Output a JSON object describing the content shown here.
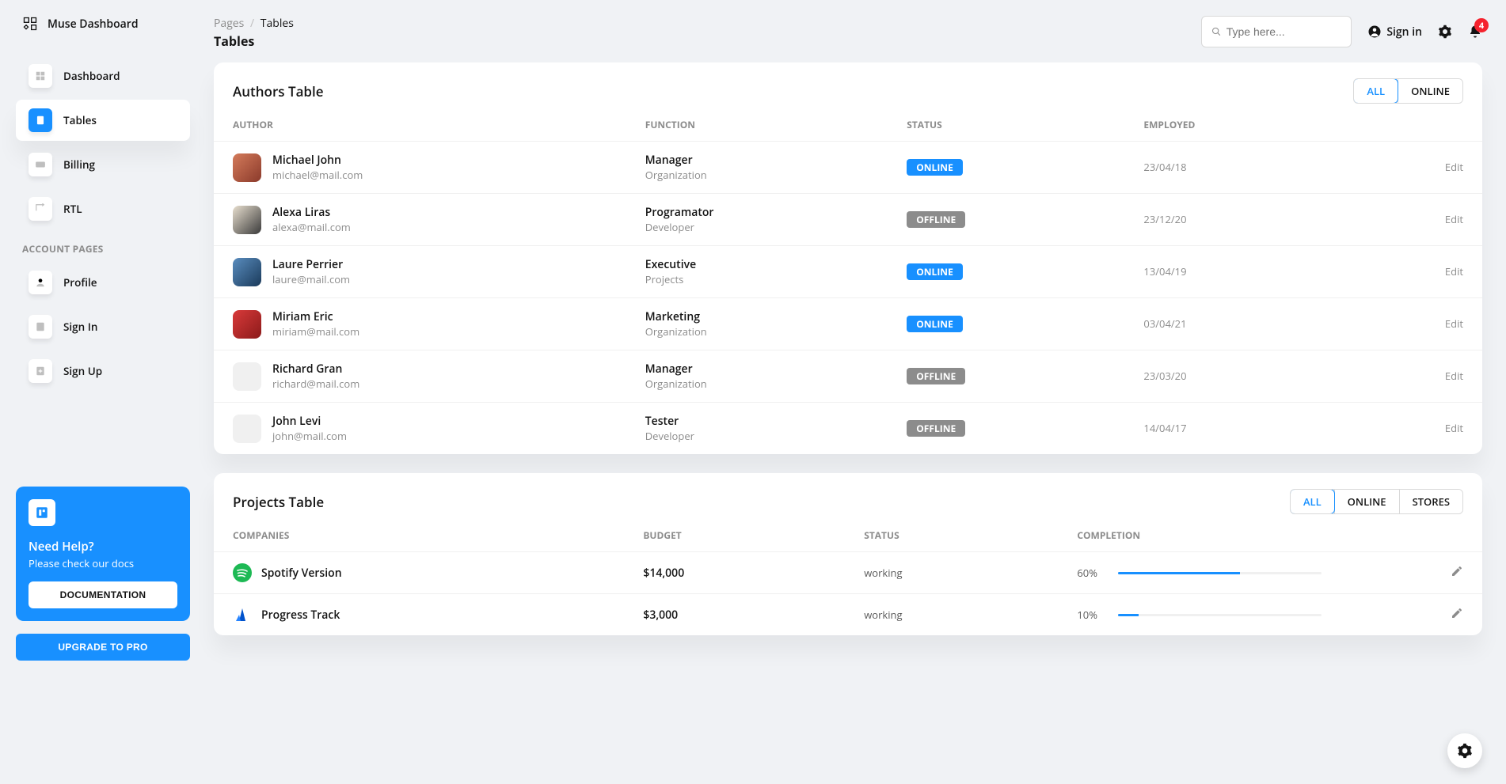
{
  "brand": {
    "name": "Muse Dashboard"
  },
  "nav": {
    "items": [
      {
        "label": "Dashboard",
        "active": false
      },
      {
        "label": "Tables",
        "active": true
      },
      {
        "label": "Billing",
        "active": false
      },
      {
        "label": "RTL",
        "active": false
      }
    ],
    "section_label": "ACCOUNT PAGES",
    "account_items": [
      {
        "label": "Profile"
      },
      {
        "label": "Sign In"
      },
      {
        "label": "Sign Up"
      }
    ]
  },
  "help": {
    "title": "Need Help?",
    "subtitle": "Please check our docs",
    "button": "DOCUMENTATION"
  },
  "upgrade_label": "UPGRADE TO PRO",
  "breadcrumb": {
    "root": "Pages",
    "separator": "/",
    "current": "Tables"
  },
  "page_title": "Tables",
  "search": {
    "placeholder": "Type here..."
  },
  "signin_label": "Sign in",
  "notif_count": "4",
  "authors_table": {
    "title": "Authors Table",
    "filters": [
      "ALL",
      "ONLINE"
    ],
    "active_filter": 0,
    "columns": [
      "AUTHOR",
      "FUNCTION",
      "STATUS",
      "EMPLOYED",
      ""
    ],
    "rows": [
      {
        "name": "Michael John",
        "email": "michael@mail.com",
        "role": "Manager",
        "dept": "Organization",
        "status": "ONLINE",
        "employed": "23/04/18",
        "avatar": "a1"
      },
      {
        "name": "Alexa Liras",
        "email": "alexa@mail.com",
        "role": "Programator",
        "dept": "Developer",
        "status": "OFFLINE",
        "employed": "23/12/20",
        "avatar": "a2"
      },
      {
        "name": "Laure Perrier",
        "email": "laure@mail.com",
        "role": "Executive",
        "dept": "Projects",
        "status": "ONLINE",
        "employed": "13/04/19",
        "avatar": "a3"
      },
      {
        "name": "Miriam Eric",
        "email": "miriam@mail.com",
        "role": "Marketing",
        "dept": "Organization",
        "status": "ONLINE",
        "employed": "03/04/21",
        "avatar": "a4"
      },
      {
        "name": "Richard Gran",
        "email": "richard@mail.com",
        "role": "Manager",
        "dept": "Organization",
        "status": "OFFLINE",
        "employed": "23/03/20",
        "avatar": "a5"
      },
      {
        "name": "John Levi",
        "email": "john@mail.com",
        "role": "Tester",
        "dept": "Developer",
        "status": "OFFLINE",
        "employed": "14/04/17",
        "avatar": "a5"
      }
    ],
    "edit_label": "Edit"
  },
  "projects_table": {
    "title": "Projects Table",
    "filters": [
      "ALL",
      "ONLINE",
      "STORES"
    ],
    "active_filter": 0,
    "columns": [
      "COMPANIES",
      "BUDGET",
      "STATUS",
      "COMPLETION",
      ""
    ],
    "rows": [
      {
        "company": "Spotify Version",
        "budget": "$14,000",
        "status": "working",
        "completion": 60,
        "logo": "spotify",
        "color": "#1db954"
      },
      {
        "company": "Progress Track",
        "budget": "$3,000",
        "status": "working",
        "completion": 10,
        "logo": "atlassian",
        "color": "#0052cc"
      }
    ]
  }
}
